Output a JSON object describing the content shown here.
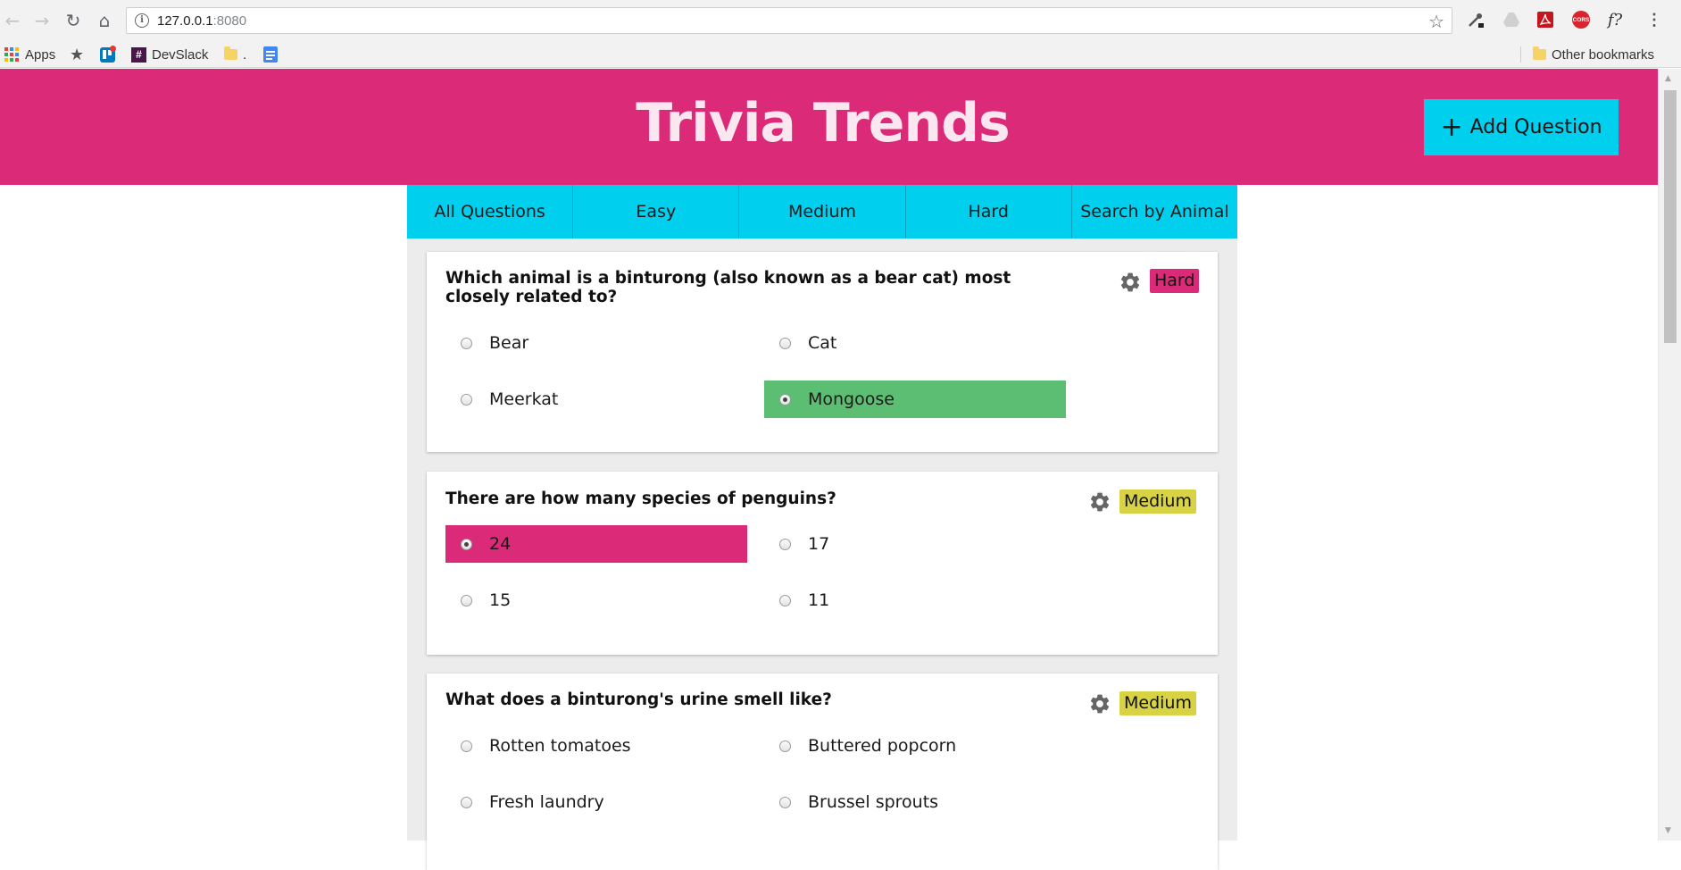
{
  "browser": {
    "url_host": "127.0.0.1",
    "url_port": ":8080",
    "bookmarks": [
      {
        "label": "Apps",
        "icon": "apps-grid-icon"
      },
      {
        "label": "",
        "icon": "star-icon"
      },
      {
        "label": "",
        "icon": "trello-icon"
      },
      {
        "label": "DevSlack",
        "icon": "slack-hash-icon"
      },
      {
        "label": ".",
        "icon": "folder-icon"
      },
      {
        "label": "",
        "icon": "google-docs-icon"
      }
    ],
    "other_bookmarks": "Other bookmarks",
    "extensions": [
      "eyedropper-icon",
      "drive-icon",
      "pdf-icon",
      "cors-icon",
      "font-question-icon",
      "menu-icon"
    ],
    "cors_label": "CORS",
    "font_label": "f?"
  },
  "app": {
    "title": "Trivia Trends",
    "add_button": "Add Question",
    "tabs": [
      "All Questions",
      "Easy",
      "Medium",
      "Hard",
      "Search by Animal"
    ]
  },
  "colors": {
    "header": "#db2b78",
    "accent": "#00cfee",
    "correct": "#5bbe72",
    "wrong": "#db2b78",
    "hard": "#db2b78",
    "medium": "#d8d245"
  },
  "questions": [
    {
      "text": "Which animal is a binturong (also known as a bear cat) most closely related to?",
      "difficulty": "Hard",
      "answers": [
        {
          "label": "Bear",
          "state": "none"
        },
        {
          "label": "Cat",
          "state": "none"
        },
        {
          "label": "Meerkat",
          "state": "none"
        },
        {
          "label": "Mongoose",
          "state": "correct",
          "checked": true
        }
      ]
    },
    {
      "text": "There are how many species of penguins?",
      "difficulty": "Medium",
      "answers": [
        {
          "label": "24",
          "state": "wrong",
          "checked": true
        },
        {
          "label": "17",
          "state": "none"
        },
        {
          "label": "15",
          "state": "none"
        },
        {
          "label": "11",
          "state": "none"
        }
      ]
    },
    {
      "text": "What does a binturong's urine smell like?",
      "difficulty": "Medium",
      "answers": [
        {
          "label": "Rotten tomatoes",
          "state": "none"
        },
        {
          "label": "Buttered popcorn",
          "state": "none"
        },
        {
          "label": "Fresh laundry",
          "state": "none"
        },
        {
          "label": "Brussel sprouts",
          "state": "none"
        }
      ]
    }
  ]
}
